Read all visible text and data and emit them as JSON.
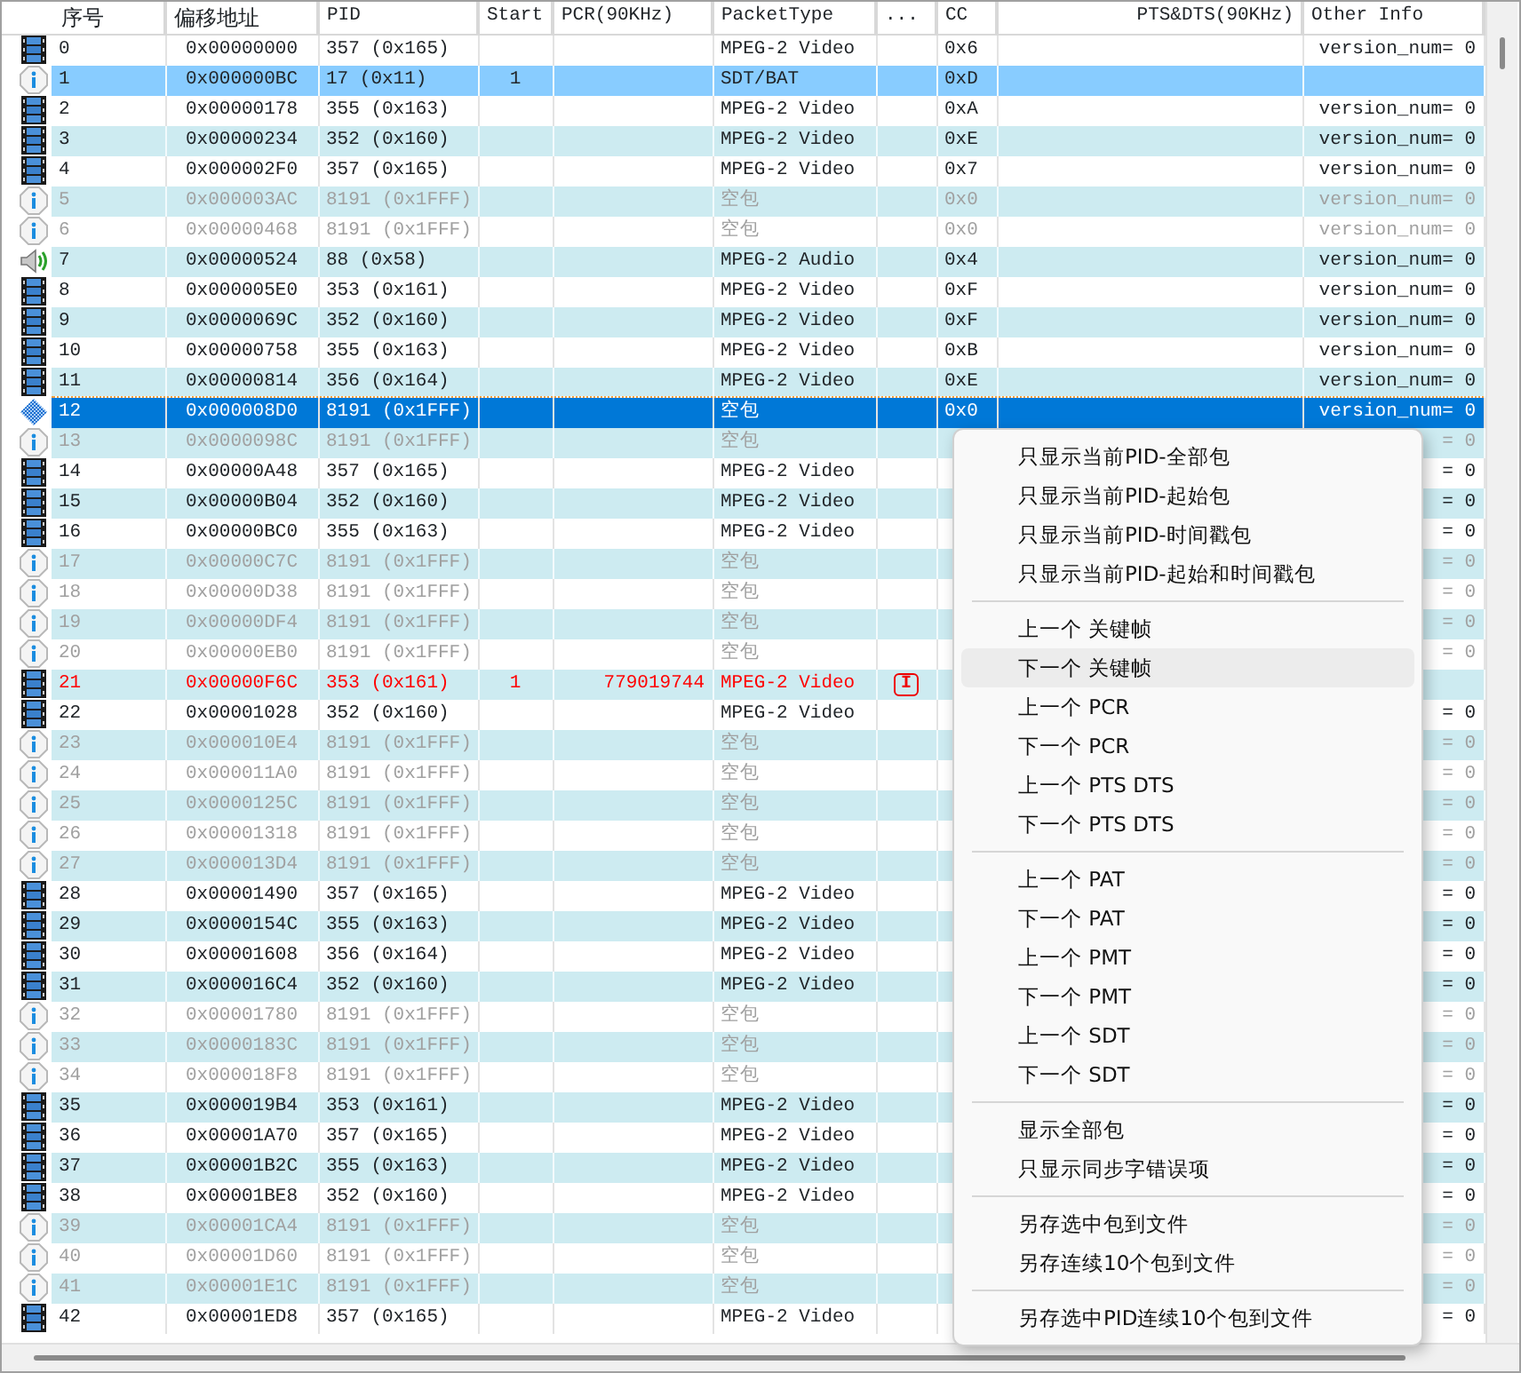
{
  "columns": [
    "序号",
    "偏移地址",
    "PID",
    "Start",
    "PCR(90KHz)",
    "PacketType",
    "...",
    "CC",
    "PTS&DTS(90KHz)",
    "Other Info"
  ],
  "rows": [
    {
      "kind": "video",
      "dimmed": false,
      "error": false,
      "highlighted": false,
      "selected": false,
      "no": "0",
      "offset": "0x00000000",
      "pid": "357 (0x165)",
      "type": "MPEG-2 Video",
      "cc": "0x6",
      "other": "version_num= 0"
    },
    {
      "kind": "info",
      "dimmed": false,
      "error": false,
      "highlighted": true,
      "selected": false,
      "no": "1",
      "offset": "0x000000BC",
      "pid": "17 (0x11)",
      "start": "1",
      "type": "SDT/BAT",
      "cc": "0xD"
    },
    {
      "kind": "video",
      "dimmed": false,
      "error": false,
      "highlighted": false,
      "selected": false,
      "no": "2",
      "offset": "0x00000178",
      "pid": "355 (0x163)",
      "type": "MPEG-2 Video",
      "cc": "0xA",
      "other": "version_num= 0"
    },
    {
      "kind": "video",
      "dimmed": false,
      "error": false,
      "highlighted": false,
      "selected": false,
      "no": "3",
      "offset": "0x00000234",
      "pid": "352 (0x160)",
      "type": "MPEG-2 Video",
      "cc": "0xE",
      "other": "version_num= 0"
    },
    {
      "kind": "video",
      "dimmed": false,
      "error": false,
      "highlighted": false,
      "selected": false,
      "no": "4",
      "offset": "0x000002F0",
      "pid": "357 (0x165)",
      "type": "MPEG-2 Video",
      "cc": "0x7",
      "other": "version_num= 0"
    },
    {
      "kind": "info",
      "dimmed": true,
      "error": false,
      "highlighted": false,
      "selected": false,
      "no": "5",
      "offset": "0x000003AC",
      "pid": "8191 (0x1FFF)",
      "type": "空包",
      "cc": "0x0",
      "other": "version_num= 0"
    },
    {
      "kind": "info",
      "dimmed": true,
      "error": false,
      "highlighted": false,
      "selected": false,
      "no": "6",
      "offset": "0x00000468",
      "pid": "8191 (0x1FFF)",
      "type": "空包",
      "cc": "0x0",
      "other": "version_num= 0"
    },
    {
      "kind": "audio",
      "dimmed": false,
      "error": false,
      "highlighted": false,
      "selected": false,
      "no": "7",
      "offset": "0x00000524",
      "pid": "88 (0x58)",
      "type": "MPEG-2 Audio",
      "cc": "0x4",
      "other": "version_num= 0"
    },
    {
      "kind": "video",
      "dimmed": false,
      "error": false,
      "highlighted": false,
      "selected": false,
      "no": "8",
      "offset": "0x000005E0",
      "pid": "353 (0x161)",
      "type": "MPEG-2 Video",
      "cc": "0xF",
      "other": "version_num= 0"
    },
    {
      "kind": "video",
      "dimmed": false,
      "error": false,
      "highlighted": false,
      "selected": false,
      "no": "9",
      "offset": "0x0000069C",
      "pid": "352 (0x160)",
      "type": "MPEG-2 Video",
      "cc": "0xF",
      "other": "version_num= 0"
    },
    {
      "kind": "video",
      "dimmed": false,
      "error": false,
      "highlighted": false,
      "selected": false,
      "no": "10",
      "offset": "0x00000758",
      "pid": "355 (0x163)",
      "type": "MPEG-2 Video",
      "cc": "0xB",
      "other": "version_num= 0"
    },
    {
      "kind": "video",
      "dimmed": false,
      "error": false,
      "highlighted": false,
      "selected": false,
      "no": "11",
      "offset": "0x00000814",
      "pid": "356 (0x164)",
      "type": "MPEG-2 Video",
      "cc": "0xE",
      "other": "version_num= 0"
    },
    {
      "kind": "focus",
      "dimmed": true,
      "error": false,
      "highlighted": false,
      "selected": true,
      "no": "12",
      "offset": "0x000008D0",
      "pid": "8191 (0x1FFF)",
      "type": "空包",
      "cc": "0x0",
      "other": "version_num= 0"
    },
    {
      "kind": "info",
      "dimmed": true,
      "error": false,
      "highlighted": false,
      "selected": false,
      "no": "13",
      "offset": "0x0000098C",
      "pid": "8191 (0x1FFF)",
      "type": "空包",
      "other": "= 0"
    },
    {
      "kind": "video",
      "dimmed": false,
      "error": false,
      "highlighted": false,
      "selected": false,
      "no": "14",
      "offset": "0x00000A48",
      "pid": "357 (0x165)",
      "type": "MPEG-2 Video",
      "other": "= 0"
    },
    {
      "kind": "video",
      "dimmed": false,
      "error": false,
      "highlighted": false,
      "selected": false,
      "no": "15",
      "offset": "0x00000B04",
      "pid": "352 (0x160)",
      "type": "MPEG-2 Video",
      "other": "= 0"
    },
    {
      "kind": "video",
      "dimmed": false,
      "error": false,
      "highlighted": false,
      "selected": false,
      "no": "16",
      "offset": "0x00000BC0",
      "pid": "355 (0x163)",
      "type": "MPEG-2 Video",
      "other": "= 0"
    },
    {
      "kind": "info",
      "dimmed": true,
      "error": false,
      "highlighted": false,
      "selected": false,
      "no": "17",
      "offset": "0x00000C7C",
      "pid": "8191 (0x1FFF)",
      "type": "空包",
      "other": "= 0"
    },
    {
      "kind": "info",
      "dimmed": true,
      "error": false,
      "highlighted": false,
      "selected": false,
      "no": "18",
      "offset": "0x00000D38",
      "pid": "8191 (0x1FFF)",
      "type": "空包",
      "other": "= 0"
    },
    {
      "kind": "info",
      "dimmed": true,
      "error": false,
      "highlighted": false,
      "selected": false,
      "no": "19",
      "offset": "0x00000DF4",
      "pid": "8191 (0x1FFF)",
      "type": "空包",
      "other": "= 0"
    },
    {
      "kind": "info",
      "dimmed": true,
      "error": false,
      "highlighted": false,
      "selected": false,
      "no": "20",
      "offset": "0x00000EB0",
      "pid": "8191 (0x1FFF)",
      "type": "空包",
      "other": "= 0"
    },
    {
      "kind": "video",
      "dimmed": false,
      "error": true,
      "highlighted": false,
      "selected": false,
      "no": "21",
      "offset": "0x00000F6C",
      "pid": "353 (0x161)",
      "start": "1",
      "pcr": "779019744",
      "type": "MPEG-2 Video",
      "flag": "I"
    },
    {
      "kind": "video",
      "dimmed": false,
      "error": false,
      "highlighted": false,
      "selected": false,
      "no": "22",
      "offset": "0x00001028",
      "pid": "352 (0x160)",
      "type": "MPEG-2 Video",
      "other": "= 0"
    },
    {
      "kind": "info",
      "dimmed": true,
      "error": false,
      "highlighted": false,
      "selected": false,
      "no": "23",
      "offset": "0x000010E4",
      "pid": "8191 (0x1FFF)",
      "type": "空包",
      "other": "= 0"
    },
    {
      "kind": "info",
      "dimmed": true,
      "error": false,
      "highlighted": false,
      "selected": false,
      "no": "24",
      "offset": "0x000011A0",
      "pid": "8191 (0x1FFF)",
      "type": "空包",
      "other": "= 0"
    },
    {
      "kind": "info",
      "dimmed": true,
      "error": false,
      "highlighted": false,
      "selected": false,
      "no": "25",
      "offset": "0x0000125C",
      "pid": "8191 (0x1FFF)",
      "type": "空包",
      "other": "= 0"
    },
    {
      "kind": "info",
      "dimmed": true,
      "error": false,
      "highlighted": false,
      "selected": false,
      "no": "26",
      "offset": "0x00001318",
      "pid": "8191 (0x1FFF)",
      "type": "空包",
      "other": "= 0"
    },
    {
      "kind": "info",
      "dimmed": true,
      "error": false,
      "highlighted": false,
      "selected": false,
      "no": "27",
      "offset": "0x000013D4",
      "pid": "8191 (0x1FFF)",
      "type": "空包",
      "other": "= 0"
    },
    {
      "kind": "video",
      "dimmed": false,
      "error": false,
      "highlighted": false,
      "selected": false,
      "no": "28",
      "offset": "0x00001490",
      "pid": "357 (0x165)",
      "type": "MPEG-2 Video",
      "other": "= 0"
    },
    {
      "kind": "video",
      "dimmed": false,
      "error": false,
      "highlighted": false,
      "selected": false,
      "no": "29",
      "offset": "0x0000154C",
      "pid": "355 (0x163)",
      "type": "MPEG-2 Video",
      "other": "= 0"
    },
    {
      "kind": "video",
      "dimmed": false,
      "error": false,
      "highlighted": false,
      "selected": false,
      "no": "30",
      "offset": "0x00001608",
      "pid": "356 (0x164)",
      "type": "MPEG-2 Video",
      "other": "= 0"
    },
    {
      "kind": "video",
      "dimmed": false,
      "error": false,
      "highlighted": false,
      "selected": false,
      "no": "31",
      "offset": "0x000016C4",
      "pid": "352 (0x160)",
      "type": "MPEG-2 Video",
      "other": "= 0"
    },
    {
      "kind": "info",
      "dimmed": true,
      "error": false,
      "highlighted": false,
      "selected": false,
      "no": "32",
      "offset": "0x00001780",
      "pid": "8191 (0x1FFF)",
      "type": "空包",
      "other": "= 0"
    },
    {
      "kind": "info",
      "dimmed": true,
      "error": false,
      "highlighted": false,
      "selected": false,
      "no": "33",
      "offset": "0x0000183C",
      "pid": "8191 (0x1FFF)",
      "type": "空包",
      "other": "= 0"
    },
    {
      "kind": "info",
      "dimmed": true,
      "error": false,
      "highlighted": false,
      "selected": false,
      "no": "34",
      "offset": "0x000018F8",
      "pid": "8191 (0x1FFF)",
      "type": "空包",
      "other": "= 0"
    },
    {
      "kind": "video",
      "dimmed": false,
      "error": false,
      "highlighted": false,
      "selected": false,
      "no": "35",
      "offset": "0x000019B4",
      "pid": "353 (0x161)",
      "type": "MPEG-2 Video",
      "other": "= 0"
    },
    {
      "kind": "video",
      "dimmed": false,
      "error": false,
      "highlighted": false,
      "selected": false,
      "no": "36",
      "offset": "0x00001A70",
      "pid": "357 (0x165)",
      "type": "MPEG-2 Video",
      "other": "= 0"
    },
    {
      "kind": "video",
      "dimmed": false,
      "error": false,
      "highlighted": false,
      "selected": false,
      "no": "37",
      "offset": "0x00001B2C",
      "pid": "355 (0x163)",
      "type": "MPEG-2 Video",
      "other": "= 0"
    },
    {
      "kind": "video",
      "dimmed": false,
      "error": false,
      "highlighted": false,
      "selected": false,
      "no": "38",
      "offset": "0x00001BE8",
      "pid": "352 (0x160)",
      "type": "MPEG-2 Video",
      "other": "= 0"
    },
    {
      "kind": "info",
      "dimmed": true,
      "error": false,
      "highlighted": false,
      "selected": false,
      "no": "39",
      "offset": "0x00001CA4",
      "pid": "8191 (0x1FFF)",
      "type": "空包",
      "other": "= 0"
    },
    {
      "kind": "info",
      "dimmed": true,
      "error": false,
      "highlighted": false,
      "selected": false,
      "no": "40",
      "offset": "0x00001D60",
      "pid": "8191 (0x1FFF)",
      "type": "空包",
      "other": "= 0"
    },
    {
      "kind": "info",
      "dimmed": true,
      "error": false,
      "highlighted": false,
      "selected": false,
      "no": "41",
      "offset": "0x00001E1C",
      "pid": "8191 (0x1FFF)",
      "type": "空包",
      "other": "= 0"
    },
    {
      "kind": "video",
      "dimmed": false,
      "error": false,
      "highlighted": false,
      "selected": false,
      "no": "42",
      "offset": "0x00001ED8",
      "pid": "357 (0x165)",
      "type": "MPEG-2 Video",
      "other": "= 0"
    }
  ],
  "context_menu": {
    "groups": [
      [
        {
          "label": "只显示当前PID-全部包",
          "hovered": false
        },
        {
          "label": "只显示当前PID-起始包",
          "hovered": false
        },
        {
          "label": "只显示当前PID-时间戳包",
          "hovered": false
        },
        {
          "label": "只显示当前PID-起始和时间戳包",
          "hovered": false
        }
      ],
      [
        {
          "label": "上一个 关键帧",
          "hovered": false
        },
        {
          "label": "下一个 关键帧",
          "hovered": true
        },
        {
          "label": "上一个 PCR",
          "hovered": false
        },
        {
          "label": "下一个 PCR",
          "hovered": false
        },
        {
          "label": "上一个 PTS DTS",
          "hovered": false
        },
        {
          "label": "下一个 PTS DTS",
          "hovered": false
        }
      ],
      [
        {
          "label": "上一个 PAT",
          "hovered": false
        },
        {
          "label": "下一个 PAT",
          "hovered": false
        },
        {
          "label": "上一个 PMT",
          "hovered": false
        },
        {
          "label": "下一个 PMT",
          "hovered": false
        },
        {
          "label": "上一个 SDT",
          "hovered": false
        },
        {
          "label": "下一个 SDT",
          "hovered": false
        }
      ],
      [
        {
          "label": "显示全部包",
          "hovered": false
        },
        {
          "label": "只显示同步字错误项",
          "hovered": false
        }
      ],
      [
        {
          "label": "另存选中包到文件",
          "hovered": false
        },
        {
          "label": "另存连续10个包到文件",
          "hovered": false
        }
      ],
      [
        {
          "label": "另存选中PID连续10个包到文件",
          "hovered": false
        }
      ]
    ]
  }
}
